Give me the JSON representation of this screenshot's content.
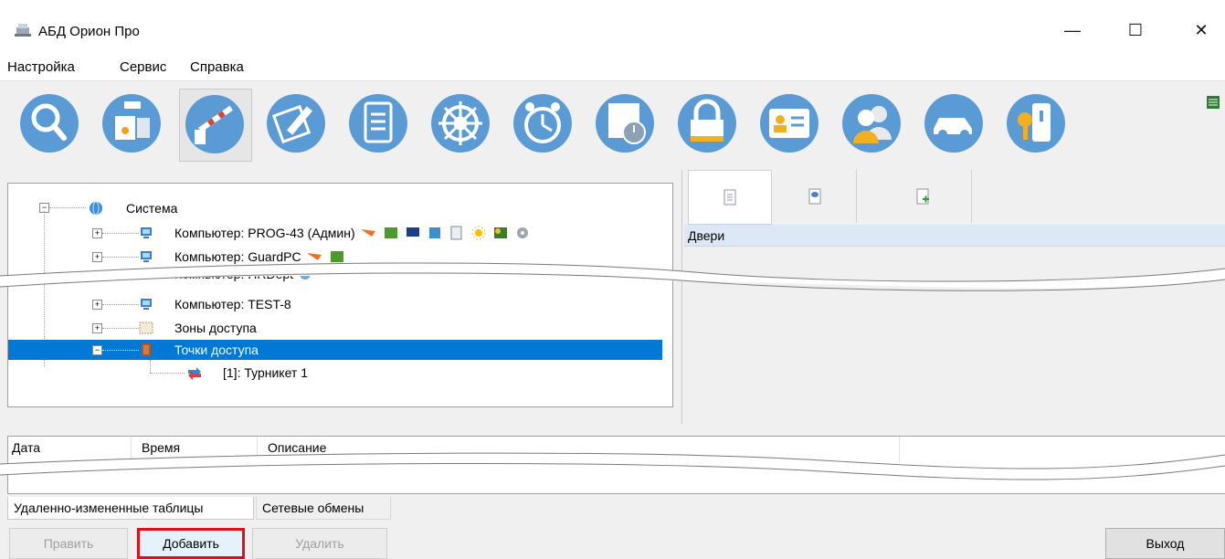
{
  "window": {
    "title": "АБД Орион Про",
    "minimize_glyph": "—",
    "maximize_glyph": "☐",
    "close_glyph": "✕"
  },
  "menu": {
    "items": [
      "Настройка",
      "Сервис",
      "Справка"
    ]
  },
  "toolbar": {
    "icons": [
      "search-icon",
      "device-icon",
      "barrier-icon",
      "edit-plan-icon",
      "document-icon",
      "steering-wheel-icon",
      "alarm-clock-icon",
      "schedule-icon",
      "lock-icon",
      "id-card-icon",
      "users-icon",
      "car-icon",
      "key-icon"
    ],
    "active_index": 2,
    "accent": "#5b9bd5"
  },
  "tree": {
    "root": "Система",
    "computer1": "Компьютер: PROG-43 (Админ)",
    "computer2": "Компьютер: GuardPC",
    "computer3": "Компьютер: HRDept",
    "computer4": "Компьютер: TEST-8",
    "zones": "Зоны доступа",
    "points": "Точки доступа",
    "turnstile": "[1]: Турникет 1"
  },
  "right_panel": {
    "tabs": [
      "document-icon",
      "comment-icon",
      "add-document-icon"
    ],
    "header": "Двери"
  },
  "log": {
    "columns": [
      "Дата",
      "Время",
      "Описание"
    ]
  },
  "bottom_tabs": {
    "tab1": "Удаленно-измененные таблицы",
    "tab2": "Сетевые обмены"
  },
  "buttons": {
    "edit": "Править",
    "add": "Добавить",
    "delete": "Удалить",
    "exit": "Выход"
  },
  "colors": {
    "selection": "#0078d7",
    "highlight_border": "#e0101a",
    "header_bg": "#dce8f5"
  }
}
